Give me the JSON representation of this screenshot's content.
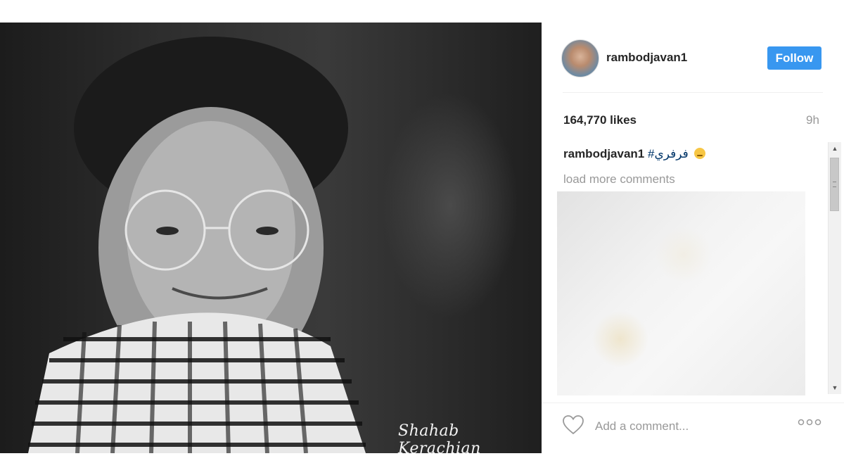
{
  "post": {
    "username": "rambodjavan1",
    "follow_label": "Follow",
    "likes": "164,770 likes",
    "time": "9h",
    "caption_user": "rambodjavan1",
    "caption_tag": "#فرفري",
    "load_more": "load more comments",
    "comment_placeholder": "Add a comment...",
    "more_options": "◦◦◦",
    "photo_signature": "Shahab Kerachian"
  },
  "icons": {
    "heart": "heart-icon",
    "more": "more-options-icon",
    "emoji": "relieved-face-icon"
  },
  "colors": {
    "follow_bg": "#3897f0",
    "hashtag": "#003569",
    "muted": "#999999",
    "text": "#262626"
  }
}
